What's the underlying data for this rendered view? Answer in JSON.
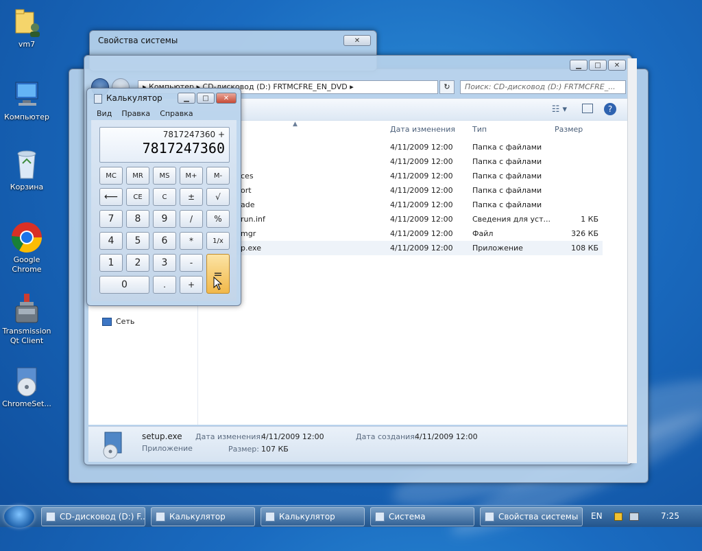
{
  "desktop": {
    "icons": [
      {
        "label": "vm7",
        "icon": "user-folder-icon"
      },
      {
        "label": "Компьютер",
        "icon": "computer-icon"
      },
      {
        "label": "Корзина",
        "icon": "recycle-bin-icon"
      },
      {
        "label": "Google Chrome",
        "icon": "chrome-icon"
      },
      {
        "label": "Transmission Qt Client",
        "icon": "transmission-icon"
      },
      {
        "label": "ChromeSet...",
        "icon": "setup-disc-icon"
      }
    ]
  },
  "bg_windows": {
    "system_props_title": "Свойства системы"
  },
  "explorer": {
    "address": "▸ Компьютер ▸ CD-дисковод (D:) FRTMCFRE_EN_DVD ▸",
    "search_placeholder": "Поиск: CD-дисковод (D:) FRTMCFRE_...",
    "columns": {
      "name": "",
      "date": "Дата изменения",
      "type": "Тип",
      "size": "Размер"
    },
    "files": [
      {
        "name": "",
        "date": "4/11/2009 12:00",
        "type": "Папка с файлами",
        "size": ""
      },
      {
        "name": "",
        "date": "4/11/2009 12:00",
        "type": "Папка с файлами",
        "size": ""
      },
      {
        "name": "ces",
        "date": "4/11/2009 12:00",
        "type": "Папка с файлами",
        "size": ""
      },
      {
        "name": "ort",
        "date": "4/11/2009 12:00",
        "type": "Папка с файлами",
        "size": ""
      },
      {
        "name": "ade",
        "date": "4/11/2009 12:00",
        "type": "Папка с файлами",
        "size": ""
      },
      {
        "name": "run.inf",
        "date": "4/11/2009 12:00",
        "type": "Сведения для уст...",
        "size": "1 КБ"
      },
      {
        "name": "mgr",
        "date": "4/11/2009 12:00",
        "type": "Файл",
        "size": "326 КБ"
      },
      {
        "name": "p.exe",
        "date": "4/11/2009 12:00",
        "type": "Приложение",
        "size": "108 КБ"
      }
    ],
    "nav_network": "Сеть",
    "details": {
      "filename": "setup.exe",
      "filetype": "Приложение",
      "modified_label": "Дата изменения:",
      "modified_value": "4/11/2009 12:00",
      "created_label": "Дата создания:",
      "created_value": "4/11/2009 12:00",
      "size_label": "Размер:",
      "size_value": "107 КБ"
    }
  },
  "calculator": {
    "title": "Калькулятор",
    "menu": [
      "Вид",
      "Правка",
      "Справка"
    ],
    "expression": "7817247360 +",
    "display": "7817247360",
    "keys": {
      "mc": "MC",
      "mr": "MR",
      "ms": "MS",
      "mplus": "M+",
      "mminus": "M-",
      "back": "⟵",
      "ce": "CE",
      "c": "C",
      "pm": "±",
      "sqrt": "√",
      "k7": "7",
      "k8": "8",
      "k9": "9",
      "div": "/",
      "pct": "%",
      "k4": "4",
      "k5": "5",
      "k6": "6",
      "mul": "*",
      "recip": "1/x",
      "k1": "1",
      "k2": "2",
      "k3": "3",
      "sub": "-",
      "eq": "=",
      "k0": "0",
      "dot": ".",
      "add": "+"
    }
  },
  "taskbar": {
    "items": [
      "CD-дисковод (D:) F...",
      "Калькулятор",
      "Калькулятор",
      "Система",
      "Свойства системы"
    ],
    "lang": "EN",
    "time": "7:25"
  }
}
